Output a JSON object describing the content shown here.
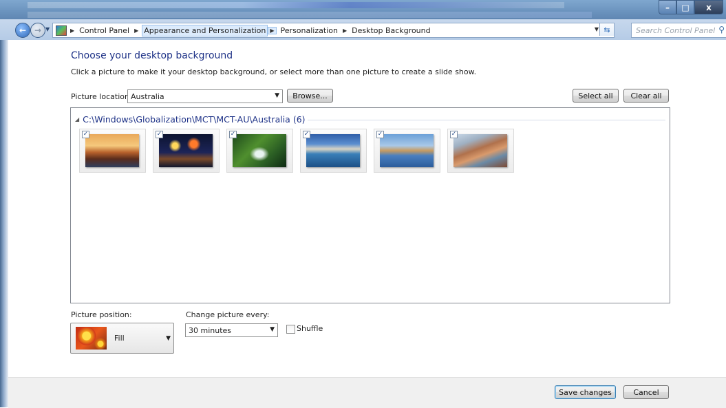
{
  "window": {
    "minimize_glyph": "–",
    "maximize_glyph": "□",
    "close_glyph": "x"
  },
  "nav": {
    "back_glyph": "←",
    "forward_glyph": "→"
  },
  "address": {
    "crumbs": [
      "Control Panel",
      "Appearance and Personalization",
      "Personalization",
      "Desktop Background"
    ],
    "highlighted_crumb": "Appearance and Personalization"
  },
  "search": {
    "placeholder": "Search Control Panel"
  },
  "page": {
    "title": "Choose your desktop background",
    "subtitle": "Click a picture to make it your desktop background, or select more than one picture to create a slide show."
  },
  "location": {
    "label": "Picture location:",
    "value": "Australia",
    "browse_label": "Browse...",
    "select_all_label": "Select all",
    "clear_all_label": "Clear all"
  },
  "gallery": {
    "group_title": "C:\\Windows\\Globalization\\MCT\\MCT-AU\\Australia (6)",
    "pictures": [
      {
        "name": "baobab-trees",
        "checked": true
      },
      {
        "name": "fireworks-harbour",
        "checked": true
      },
      {
        "name": "rainforest-stream",
        "checked": true
      },
      {
        "name": "sydney-harbour",
        "checked": true
      },
      {
        "name": "twelve-apostles",
        "checked": true
      },
      {
        "name": "kimberley-gorge",
        "checked": true
      }
    ],
    "check_glyph": "✓"
  },
  "position": {
    "label": "Picture position:",
    "value": "Fill"
  },
  "interval": {
    "label": "Change picture every:",
    "value": "30 minutes"
  },
  "shuffle": {
    "label": "Shuffle",
    "checked": false
  },
  "footer": {
    "save_label": "Save changes",
    "cancel_label": "Cancel"
  },
  "colors": {
    "heading": "#1e3287",
    "titlebar": "#6b93be",
    "footer_bg": "#f0f0f0"
  }
}
